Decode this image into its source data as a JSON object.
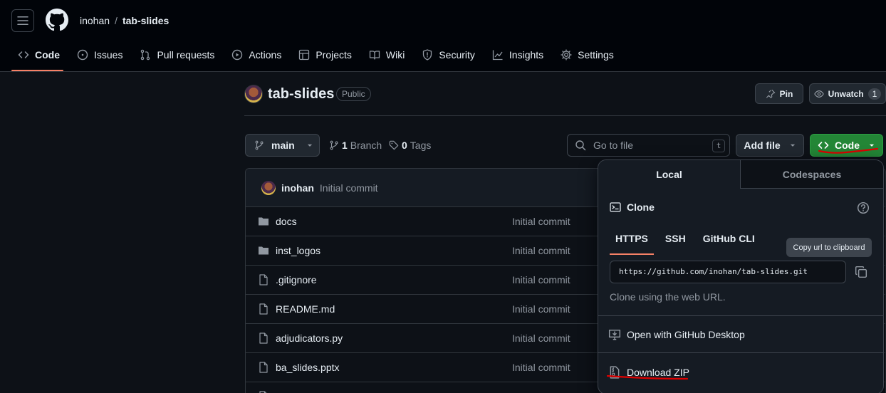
{
  "header": {
    "owner": "inohan",
    "separator": "/",
    "repo": "tab-slides",
    "tabs": [
      {
        "label": "Code",
        "icon": "code-icon",
        "active": true
      },
      {
        "label": "Issues",
        "icon": "issue-icon"
      },
      {
        "label": "Pull requests",
        "icon": "pull-request-icon"
      },
      {
        "label": "Actions",
        "icon": "play-icon"
      },
      {
        "label": "Projects",
        "icon": "table-icon"
      },
      {
        "label": "Wiki",
        "icon": "book-icon"
      },
      {
        "label": "Security",
        "icon": "shield-icon"
      },
      {
        "label": "Insights",
        "icon": "graph-icon"
      },
      {
        "label": "Settings",
        "icon": "gear-icon"
      }
    ]
  },
  "repo": {
    "name": "tab-slides",
    "visibility": "Public",
    "pin_label": "Pin",
    "watch_label": "Unwatch",
    "watch_count": "1"
  },
  "toolbar": {
    "branch": "main",
    "branch_count": "1",
    "branch_label": "Branch",
    "tag_count": "0",
    "tag_label": "Tags",
    "goto_placeholder": "Go to file",
    "goto_kbd": "t",
    "add_file_label": "Add file",
    "code_label": "Code"
  },
  "commit": {
    "author": "inohan",
    "message": "Initial commit"
  },
  "files": [
    {
      "name": "docs",
      "type": "folder",
      "commit": "Initial commit"
    },
    {
      "name": "inst_logos",
      "type": "folder",
      "commit": "Initial commit"
    },
    {
      "name": ".gitignore",
      "type": "file",
      "commit": "Initial commit"
    },
    {
      "name": "README.md",
      "type": "file",
      "commit": "Initial commit"
    },
    {
      "name": "adjudicators.py",
      "type": "file",
      "commit": "Initial commit"
    },
    {
      "name": "ba_slides.pptx",
      "type": "file",
      "commit": "Initial commit"
    }
  ],
  "code_panel": {
    "tab_local": "Local",
    "tab_codespaces": "Codespaces",
    "clone_title": "Clone",
    "protocols": [
      "HTTPS",
      "SSH",
      "GitHub CLI"
    ],
    "active_protocol": "HTTPS",
    "tooltip": "Copy url to clipboard",
    "clone_url": "https://github.com/inohan/tab-slides.git",
    "clone_hint": "Clone using the web URL.",
    "open_desktop": "Open with GitHub Desktop",
    "download_zip": "Download ZIP"
  },
  "colors": {
    "background": "#0d1117",
    "header_bg": "#010409",
    "accent_underline": "#f78166",
    "primary_button": "#238636",
    "annotation_red": "#e00000"
  }
}
